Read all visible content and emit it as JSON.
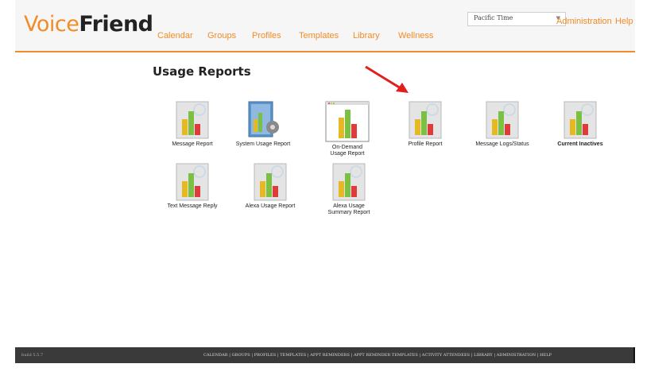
{
  "app": {
    "logo_part1": "Voice",
    "logo_part2": "Friend",
    "nav": [
      "Calendar",
      "Groups",
      "Profiles",
      "Templates",
      "Library",
      "Wellness"
    ],
    "timezone": "Pacific Time",
    "admin_link": "Administration",
    "help_link": "Help"
  },
  "page": {
    "title": "Usage Reports"
  },
  "colors": {
    "accent": "#f28c28",
    "arrow": "#e0201c",
    "footer": "#3a3a3a"
  },
  "reports": [
    {
      "label": "Message Report",
      "icon": "report-chart-icon"
    },
    {
      "label": "System Usage Report",
      "icon": "system-usage-icon"
    },
    {
      "label": "On-Demand\nUsage Report",
      "icon": "on-demand-chart-icon"
    },
    {
      "label": "Profile Report",
      "icon": "report-chart-icon"
    },
    {
      "label": "Message Logs/Status",
      "icon": "report-chart-icon"
    },
    {
      "label": "Current Inactives",
      "icon": "report-chart-icon"
    },
    {
      "label": "Text Message Reply",
      "icon": "report-chart-icon"
    },
    {
      "label": "Alexa Usage Report",
      "icon": "report-chart-icon"
    },
    {
      "label": "Alexa Usage\nSummary Report",
      "icon": "report-chart-icon"
    }
  ],
  "footer": {
    "build": "build 5.5.7",
    "links": "CALENDAR | GROUPS | PROFILES | TEMPLATES | APPT REMINDERS | APPT REMINDER TEMPLATES | ACTIVITY ATTENDEES | LIBRARY | ADMINISTRATION | HELP"
  }
}
